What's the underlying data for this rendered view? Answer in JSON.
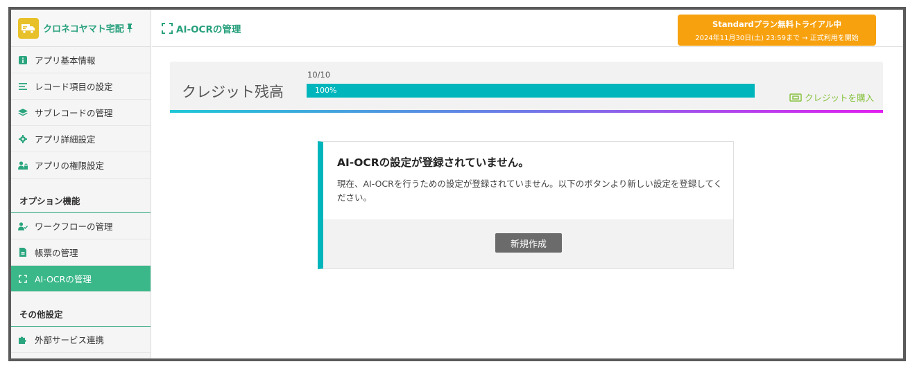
{
  "app": {
    "name": "クロネコヤマト宅配"
  },
  "sidebar": {
    "items": [
      {
        "label": "アプリ基本情報"
      },
      {
        "label": "レコード項目の設定"
      },
      {
        "label": "サブレコードの管理"
      },
      {
        "label": "アプリ詳細設定"
      },
      {
        "label": "アプリの権限設定"
      }
    ],
    "section_options": "オプション機能",
    "option_items": [
      {
        "label": "ワークフローの管理"
      },
      {
        "label": "帳票の管理"
      },
      {
        "label": "AI-OCRの管理"
      }
    ],
    "section_other": "その他設定",
    "other_items": [
      {
        "label": "外部サービス連携"
      }
    ]
  },
  "header": {
    "title": "AI-OCRの管理",
    "trial_title": "Standardプラン無料トライアル中",
    "trial_sub": "2024年11月30日(土) 23:59まで → 正式利用を開始"
  },
  "credit": {
    "title": "クレジット残高",
    "count": "10/10",
    "percent_label": "100%",
    "fill_fraction": 1.0,
    "buy_label": "クレジットを購入"
  },
  "notice": {
    "title": "AI-OCRの設定が登録されていません。",
    "body": "現在、AI-OCRを行うための設定が登録されていません。以下のボタンより新しい設定を登録してください。",
    "button_label": "新規作成"
  },
  "colors": {
    "accent_green": "#27a07c",
    "active_green": "#3ab88a",
    "teal": "#00b6bc",
    "trial_orange": "#f7a10f",
    "buy_green": "#86c23e"
  }
}
